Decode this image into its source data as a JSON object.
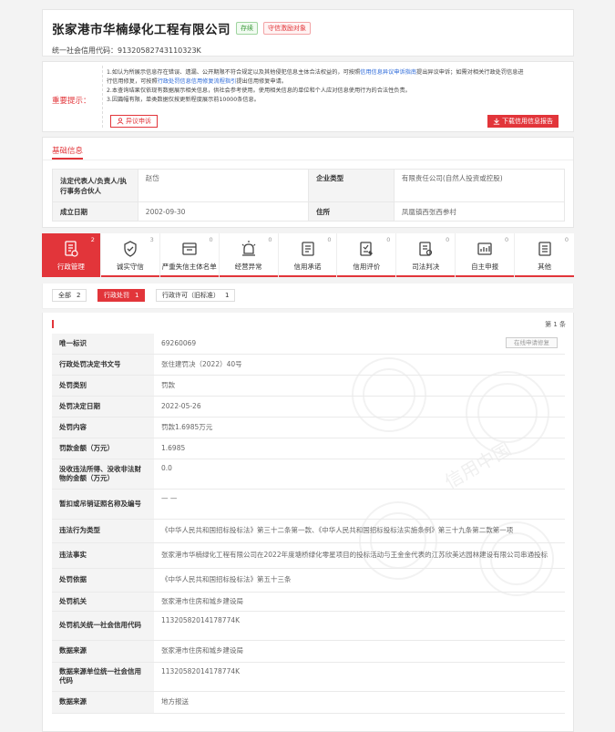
{
  "company": {
    "name": "张家港市华楠绿化工程有限公司",
    "status_tag": "存续",
    "focus_tag": "守信激励对象",
    "credit_code_label": "统一社会信用代码：",
    "credit_code": "91320582743110323K"
  },
  "notice": {
    "label": "重要提示：",
    "line1_a": "1.如认为所展示信息存在错误、遗漏、公开期限不符合规定以及其他侵犯信息主体合法权益的，可按照",
    "line1_link": "信用信息异议申诉指南",
    "line1_b": "提出异议申诉；如需对相关行政处罚信息进",
    "line2_a": "行信用修复，可按照",
    "line2_link": "行政处罚信息信用修复流程指引",
    "line2_b": "提出信用修复申请。",
    "line3": "2.本查询结果仅依现有数据展示相关信息，供社会参考使用。使用相关信息的单位和个人应对信息使用行为的合法性负责。",
    "line4": "3.因篇幅有限，单类数据仅按更新程度展示前10000条信息。",
    "objection_button": "异议申诉",
    "download_button": "下载信用信息报告"
  },
  "basic": {
    "title": "基础信息",
    "rows": [
      {
        "k1": "法定代表人/负责人/执行事务合伙人",
        "v1": "赵岱",
        "k2": "企业类型",
        "v2": "有限责任公司(自然人投资或控股)"
      },
      {
        "k1": "成立日期",
        "v1": "2002-09-30",
        "k2": "住所",
        "v2": "凤凰镇西张西参村"
      }
    ]
  },
  "tabs": [
    {
      "label": "行政管理",
      "count": "2",
      "icon": "admin-doc-icon"
    },
    {
      "label": "诚实守信",
      "count": "3",
      "icon": "honesty-shield-icon"
    },
    {
      "label": "严重失信主体名单",
      "count": "0",
      "icon": "blacklist-icon"
    },
    {
      "label": "经营异常",
      "count": "0",
      "icon": "alarm-icon"
    },
    {
      "label": "信用承诺",
      "count": "0",
      "icon": "commitment-icon"
    },
    {
      "label": "信用评价",
      "count": "0",
      "icon": "evaluation-icon"
    },
    {
      "label": "司法判决",
      "count": "0",
      "icon": "judgment-icon"
    },
    {
      "label": "自主申报",
      "count": "0",
      "icon": "declaration-icon"
    },
    {
      "label": "其他",
      "count": "0",
      "icon": "other-icon"
    }
  ],
  "filters": [
    {
      "label": "全部",
      "count": "2"
    },
    {
      "label": "行政处罚",
      "count": "1"
    },
    {
      "label": "行政许可（旧标准）",
      "count": "1"
    }
  ],
  "records": {
    "total": "第 1 条",
    "fix_button": "在线申请修复",
    "rows": [
      {
        "k": "唯一标识",
        "v": "69260069"
      },
      {
        "k": "行政处罚决定书文号",
        "v": "张住建罚决（2022）40号"
      },
      {
        "k": "处罚类别",
        "v": "罚款"
      },
      {
        "k": "处罚决定日期",
        "v": "2022-05-26"
      },
      {
        "k": "处罚内容",
        "v": "罚款1.6985万元"
      },
      {
        "k": "罚款金额（万元）",
        "v": "1.6985"
      },
      {
        "k": "没收违法所得、没收非法财物的金额（万元）",
        "v": "0.0"
      },
      {
        "k": "暂扣或吊销证照名称及编号",
        "v": "— —"
      },
      {
        "k": "违法行为类型",
        "v": "《中华人民共和国招标投标法》第三十二条第一款、《中华人民共和国招标投标法实施条例》第三十九条第二款第一项"
      },
      {
        "k": "违法事实",
        "v": "张家港市华楠绿化工程有限公司在2022年度塘桥绿化零星项目的投标活动与王金金代表的江苏欣美达园林建设有限公司串通投标"
      },
      {
        "k": "处罚依据",
        "v": "《中华人民共和国招标投标法》第五十三条"
      },
      {
        "k": "处罚机关",
        "v": "张家港市住房和城乡建设局"
      },
      {
        "k": "处罚机关统一社会信用代码",
        "v": "11320582014178774K"
      },
      {
        "k": "数据来源",
        "v": "张家港市住房和城乡建设局"
      },
      {
        "k": "数据来源单位统一社会信用代码",
        "v": "11320582014178774K"
      },
      {
        "k": "数据来源",
        "v": "地方报送"
      }
    ]
  },
  "watermark_text": "信用中国",
  "colors": {
    "accent": "#e2353a",
    "link": "#2b69d9",
    "status_green": "#3a9a3a"
  }
}
